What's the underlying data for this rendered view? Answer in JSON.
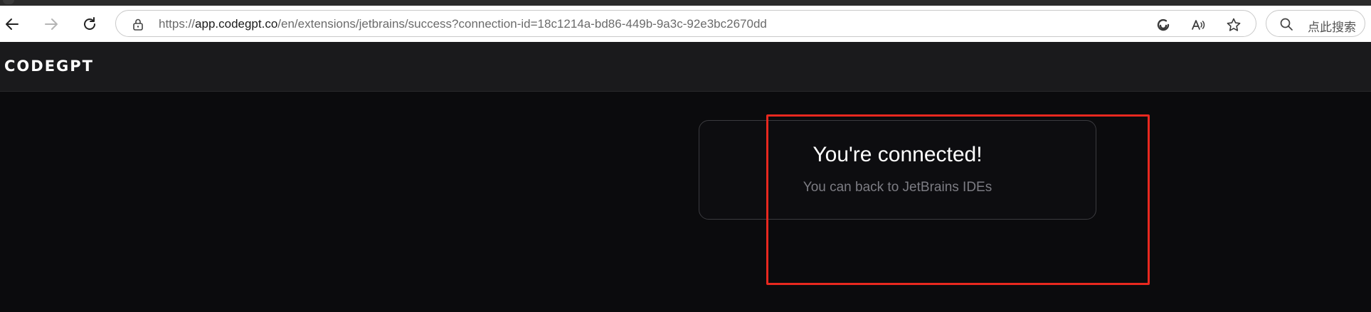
{
  "browser": {
    "url_prefix": "https://",
    "url_host": "app.codegpt.co",
    "url_path": "/en/extensions/jetbrains/success?connection-id=18c1214a-bd86-449b-9a3c-92e3bc2670dd",
    "search_placeholder": "点此搜索"
  },
  "app": {
    "logo": "CODEGPT"
  },
  "card": {
    "title": "You're connected!",
    "subtitle": "You can back to JetBrains IDEs"
  },
  "colors": {
    "highlight": "#e8281f",
    "background": "#0b0b0d",
    "header": "#1a1a1c"
  }
}
